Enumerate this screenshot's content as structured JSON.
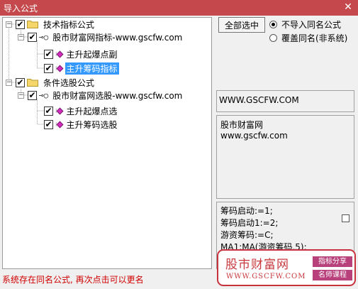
{
  "window": {
    "title": "导入公式",
    "close_glyph": "✕"
  },
  "tree": {
    "groups": [
      {
        "label": "技术指标公式",
        "expander": "−",
        "items": [
          {
            "label": "股市财富网指标-www.gscfw.com",
            "expander": "−",
            "children": [
              {
                "label": "主升起爆点副",
                "selected": false
              },
              {
                "label": "主升筹码指标",
                "selected": true
              }
            ]
          }
        ]
      },
      {
        "label": "条件选股公式",
        "expander": "−",
        "items": [
          {
            "label": "股市财富网选股-www.gscfw.com",
            "expander": "−",
            "children": [
              {
                "label": "主升起爆点选",
                "selected": false
              },
              {
                "label": "主升筹码选股",
                "selected": false
              }
            ]
          }
        ]
      }
    ],
    "checked_glyph": "✔"
  },
  "options": {
    "select_all_label": "全部选中",
    "radios": [
      {
        "label": "不导入同名公式",
        "checked": true
      },
      {
        "label": "覆盖同名(非系统)",
        "checked": false
      }
    ]
  },
  "info": {
    "source_url": "WWW.GSCFW.COM",
    "desc_line1": "股市财富网",
    "desc_line2": "www.gscfw.com"
  },
  "code": {
    "lines": [
      "筹码启动:=1;",
      "筹码启动1:=2;",
      "游资筹码:=C;",
      "MA1:MA(游资筹码,5);"
    ]
  },
  "banner": {
    "brand": "股市财富网",
    "url": "WWW.GSCFW.COM",
    "tag1": "指标分享",
    "tag2": "名师课程",
    "accent": "#c8323c"
  },
  "status": {
    "message": "系统存在同名公式, 再次点击可以更名"
  },
  "colors": {
    "titlebar": "#c4484c",
    "selection": "#3399ff",
    "status": "#d00000"
  }
}
